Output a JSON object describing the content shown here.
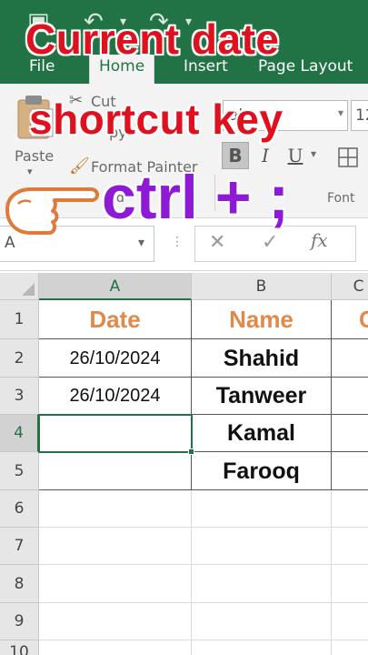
{
  "ribbon_tabs": [
    {
      "label": "File",
      "active": false
    },
    {
      "label": "Home",
      "active": true
    },
    {
      "label": "Insert",
      "active": false
    },
    {
      "label": "Page Layout",
      "active": false
    }
  ],
  "clipboard": {
    "paste_label": "Paste",
    "cut_label": "Cut",
    "copy_label": "py",
    "format_painter_label": "Format Painter",
    "group_label": "d"
  },
  "font_group": {
    "font_size": "12",
    "font_name_partial": "al",
    "bold_label": "B",
    "italic_label": "I",
    "underline_label": "U",
    "group_label": "Font"
  },
  "formula_bar": {
    "name_box": "A",
    "cancel_symbol": "✕",
    "enter_symbol": "✓",
    "fx_label": "fx"
  },
  "columns": [
    "A",
    "B",
    "C"
  ],
  "rows": [
    "1",
    "2",
    "3",
    "4",
    "5",
    "6",
    "7",
    "8",
    "9",
    "10"
  ],
  "cells": {
    "header_date": "Date",
    "header_name": "Name",
    "header_c_partial": "C",
    "row2_date": "26/10/2024",
    "row3_date": "26/10/2024",
    "row2_name": "Shahid",
    "row3_name": "Tanweer",
    "row4_name": "Kamal",
    "row5_name": "Farooq"
  },
  "overlay": {
    "line1": "Current date",
    "line2": "shortcut key",
    "shortcut": "ctrl + ;"
  },
  "colors": {
    "excel_green": "#217346",
    "header_orange": "#e0894a",
    "caption_red": "#e0111f",
    "caption_purple": "#8e1ad6"
  }
}
